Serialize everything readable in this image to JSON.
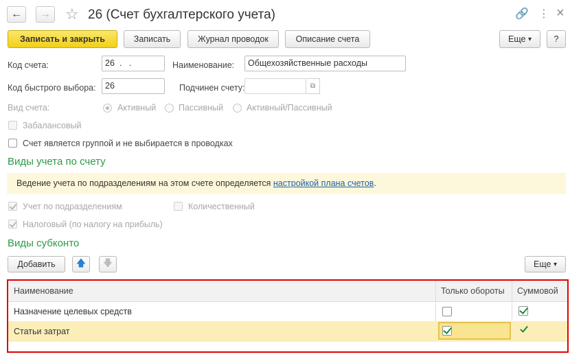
{
  "window": {
    "title": "26 (Счет бухгалтерского учета)",
    "back_icon": "←",
    "forward_icon": "→",
    "star_icon": "☆",
    "link_icon": "🔗",
    "more_icon": "⋮",
    "close_icon": "×"
  },
  "toolbar": {
    "save_close": "Записать и закрыть",
    "save": "Записать",
    "journal": "Журнал проводок",
    "description": "Описание счета",
    "more": "Еще",
    "more_arrow": "▾",
    "help": "?"
  },
  "form": {
    "account_code_label": "Код счета:",
    "account_code_value": "26  .   .",
    "name_label": "Наименование:",
    "name_value": "Общехозяйственные расходы",
    "quick_code_label": "Код быстрого выбора:",
    "quick_code_value": "26",
    "parent_label": "Подчинен счету:",
    "parent_value": "",
    "pick_icon": "⧉",
    "kind_label": "Вид счета:",
    "kind_options": [
      "Активный",
      "Пассивный",
      "Активный/Пассивный"
    ],
    "off_balance_label": "Забалансовый",
    "group_label": "Счет является группой и не выбирается в проводках"
  },
  "accounting_section": {
    "title": "Виды учета по счету",
    "info_text": "Ведение учета по подразделениям на этом счете определяется",
    "info_link": "настройкой плана счетов",
    "info_end": ".",
    "dept_label": "Учет по подразделениям",
    "quantity_label": "Количественный",
    "tax_label": "Налоговый (по налогу на прибыль)"
  },
  "subconto_section": {
    "title": "Виды субконто",
    "add_button": "Добавить",
    "up_icon": "🡅",
    "down_icon": "🡇",
    "more": "Еще",
    "more_arrow": "▾",
    "columns": [
      "Наименование",
      "Только обороты",
      "Суммовой"
    ],
    "rows": [
      {
        "name": "Назначение целевых средств",
        "turnover_only": false,
        "sum": true
      },
      {
        "name": "Статьи затрат",
        "turnover_only": true,
        "sum": true
      }
    ]
  },
  "colors": {
    "accent_green": "#2b9a48",
    "primary_button": "#f2cf17",
    "highlight_border": "#e00000",
    "selected_row": "#fbeeb9"
  }
}
